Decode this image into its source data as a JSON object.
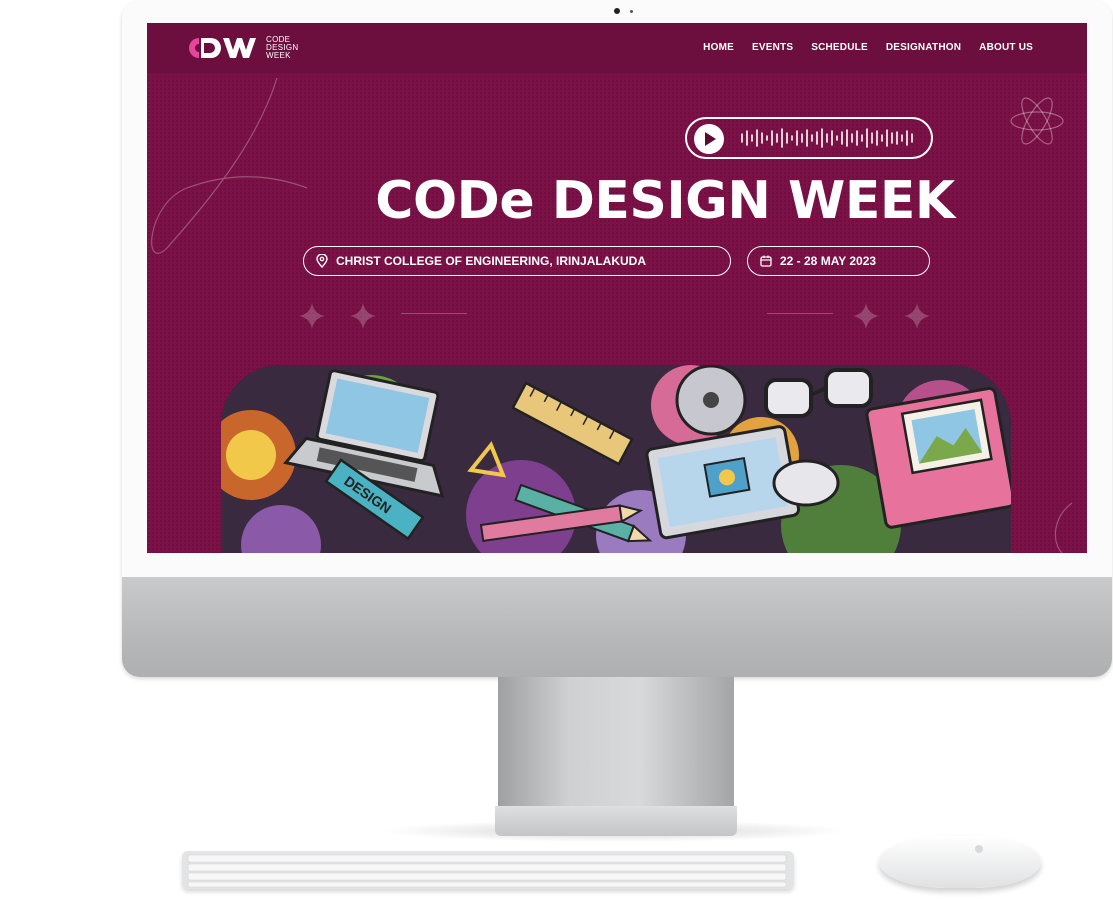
{
  "site": {
    "logo": {
      "mark": "CDW",
      "lines": [
        "CODE",
        "DESIGN",
        "WEEK"
      ]
    },
    "nav": [
      "HOME",
      "EVENTS",
      "SCHEDULE",
      "DESIGNATHON",
      "ABOUT US"
    ],
    "hero": {
      "title": "CODe DESIGN WEEK",
      "location": "CHRIST COLLEGE OF ENGINEERING, IRINJALAKUDA",
      "dates": "22 - 28 MAY 2023"
    }
  },
  "colors": {
    "background": "#7b1147",
    "navbar": "#6c0f3e",
    "accent": "#e5459b",
    "text": "#ffffff"
  },
  "icons": [
    "play-icon",
    "waveform-icon",
    "location-pin-icon",
    "calendar-icon",
    "sparkle-icon",
    "atom-icon"
  ]
}
